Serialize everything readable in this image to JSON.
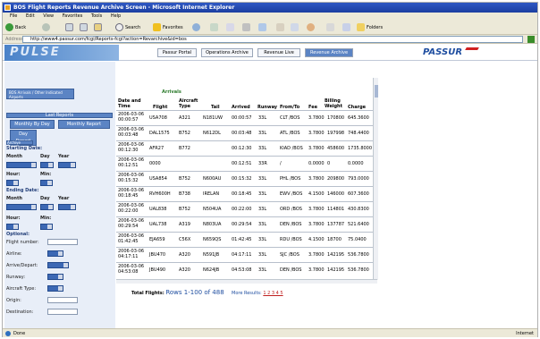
{
  "window": {
    "title": "BOS Flight Reports Revenue Archive Screen - Microsoft Internet Explorer"
  },
  "menu": [
    "File",
    "Edit",
    "View",
    "Favorites",
    "Tools",
    "Help"
  ],
  "toolbar": {
    "back": "Back",
    "search": "Search",
    "favorites": "Favorites",
    "folders": "Folders"
  },
  "address": {
    "label": "Address",
    "url": "http://www4.passur.com/fcgi/Reports-fcgi?action=Revarchive&id=bos"
  },
  "app": {
    "logo": "PULSE",
    "brand": "PASSUR",
    "nav": [
      "Passur Portal",
      "Operations Archive",
      "Revenue Live",
      "Revenue Archive"
    ],
    "active_nav_index": 3
  },
  "sidebar": {
    "top_button": "BOS Arrivals / Other Indicated Airports",
    "last_reports_label": "Last Reports",
    "monthly_by_day": "Monthly By Day",
    "monthly_report": "Monthly Report",
    "day_report": "Day Report",
    "archive_search": "Archive Search",
    "starting_date": "Starting Date:",
    "ending_date": "Ending Date:",
    "month": "Month",
    "day": "Day",
    "year": "Year",
    "hour": "Hour:",
    "min": "Min:",
    "optional": "Optional:",
    "flight_number": "Flight number:",
    "airline": "Airline:",
    "arrive_depart": "Arrive/Depart:",
    "runway": "Runway:",
    "aircraft_type": "Aircraft Type:",
    "origin": "Origin:",
    "destination": "Destination:"
  },
  "table": {
    "group_label": "Arrivals",
    "headers": [
      "Date and Time",
      "Flight",
      "Aircraft Type",
      "Tail",
      "Arrived",
      "Runway",
      "From/To",
      "Fee",
      "Billing Weight",
      "Charge"
    ],
    "rows": [
      [
        "2006-03-06 00:00:57",
        "USA708",
        "A321",
        "N181UW",
        "00:00:57",
        "33L",
        "CLT /BOS",
        "3.7800",
        "170800",
        "645.3600"
      ],
      [
        "2006-03-06 00:03:48",
        "DAL1575",
        "B752",
        "N612DL",
        "00:03:48",
        "33L",
        "ATL /BOS",
        "3.7800",
        "197998",
        "748.4400"
      ],
      [
        "2006-03-06 00:12:30",
        "AFR27",
        "B772",
        "",
        "00:12:30",
        "33L",
        "KIAD /BOS",
        "3.7800",
        "458600",
        "1735.8000"
      ],
      [
        "2006-03-06 00:12:51",
        "0000",
        "",
        "",
        "00:12:51",
        "33R",
        "/",
        "0.0000",
        "0",
        "0.0000"
      ],
      [
        "2006-03-06 00:15:32",
        "USA854",
        "B752",
        "N600AU",
        "00:15:32",
        "33L",
        "PHL /BOS",
        "3.7800",
        "209800",
        "793.0000"
      ],
      [
        "2006-03-06 00:18:45",
        "RVH600H",
        "B738",
        "IRELAN",
        "00:18:45",
        "33L",
        "EWV /BOS",
        "4.1500",
        "146000",
        "607.3600"
      ],
      [
        "2006-03-06 00:22:00",
        "UAL838",
        "B752",
        "N504UA",
        "00:22:00",
        "33L",
        "ORD /BOS",
        "3.7800",
        "114801",
        "430.8300"
      ],
      [
        "2006-03-06 00:29:54",
        "UAL738",
        "A319",
        "N803UA",
        "00:29:54",
        "33L",
        "DEN /BOS",
        "3.7800",
        "137787",
        "521.6400"
      ],
      [
        "2006-03-06 01:42:45",
        "EJA659",
        "C56X",
        "N659QS",
        "01:42:45",
        "33L",
        "RDU /BOS",
        "4.1500",
        "18700",
        "75.0400"
      ],
      [
        "2006-03-06 04:17:11",
        "JBU470",
        "A320",
        "N591JB",
        "04:17:11",
        "33L",
        "SJC /BOS",
        "3.7800",
        "142195",
        "536.7800"
      ],
      [
        "2006-03-06 04:53:08",
        "JBU490",
        "A320",
        "N624JB",
        "04:53:08",
        "33L",
        "DEN /BOS",
        "3.7800",
        "142195",
        "536.7800"
      ]
    ]
  },
  "footer": {
    "total_label": "Total Flights:",
    "rows_text": "Rows 1-100 of 488",
    "more_results": "More Results:",
    "pages": "1 2 3 4 5"
  },
  "status": {
    "text": "Done",
    "zone": "Internet"
  },
  "colors": {
    "accent": "#5b84c4",
    "brand": "#1f4ea0",
    "title": "#1b3ea0"
  }
}
